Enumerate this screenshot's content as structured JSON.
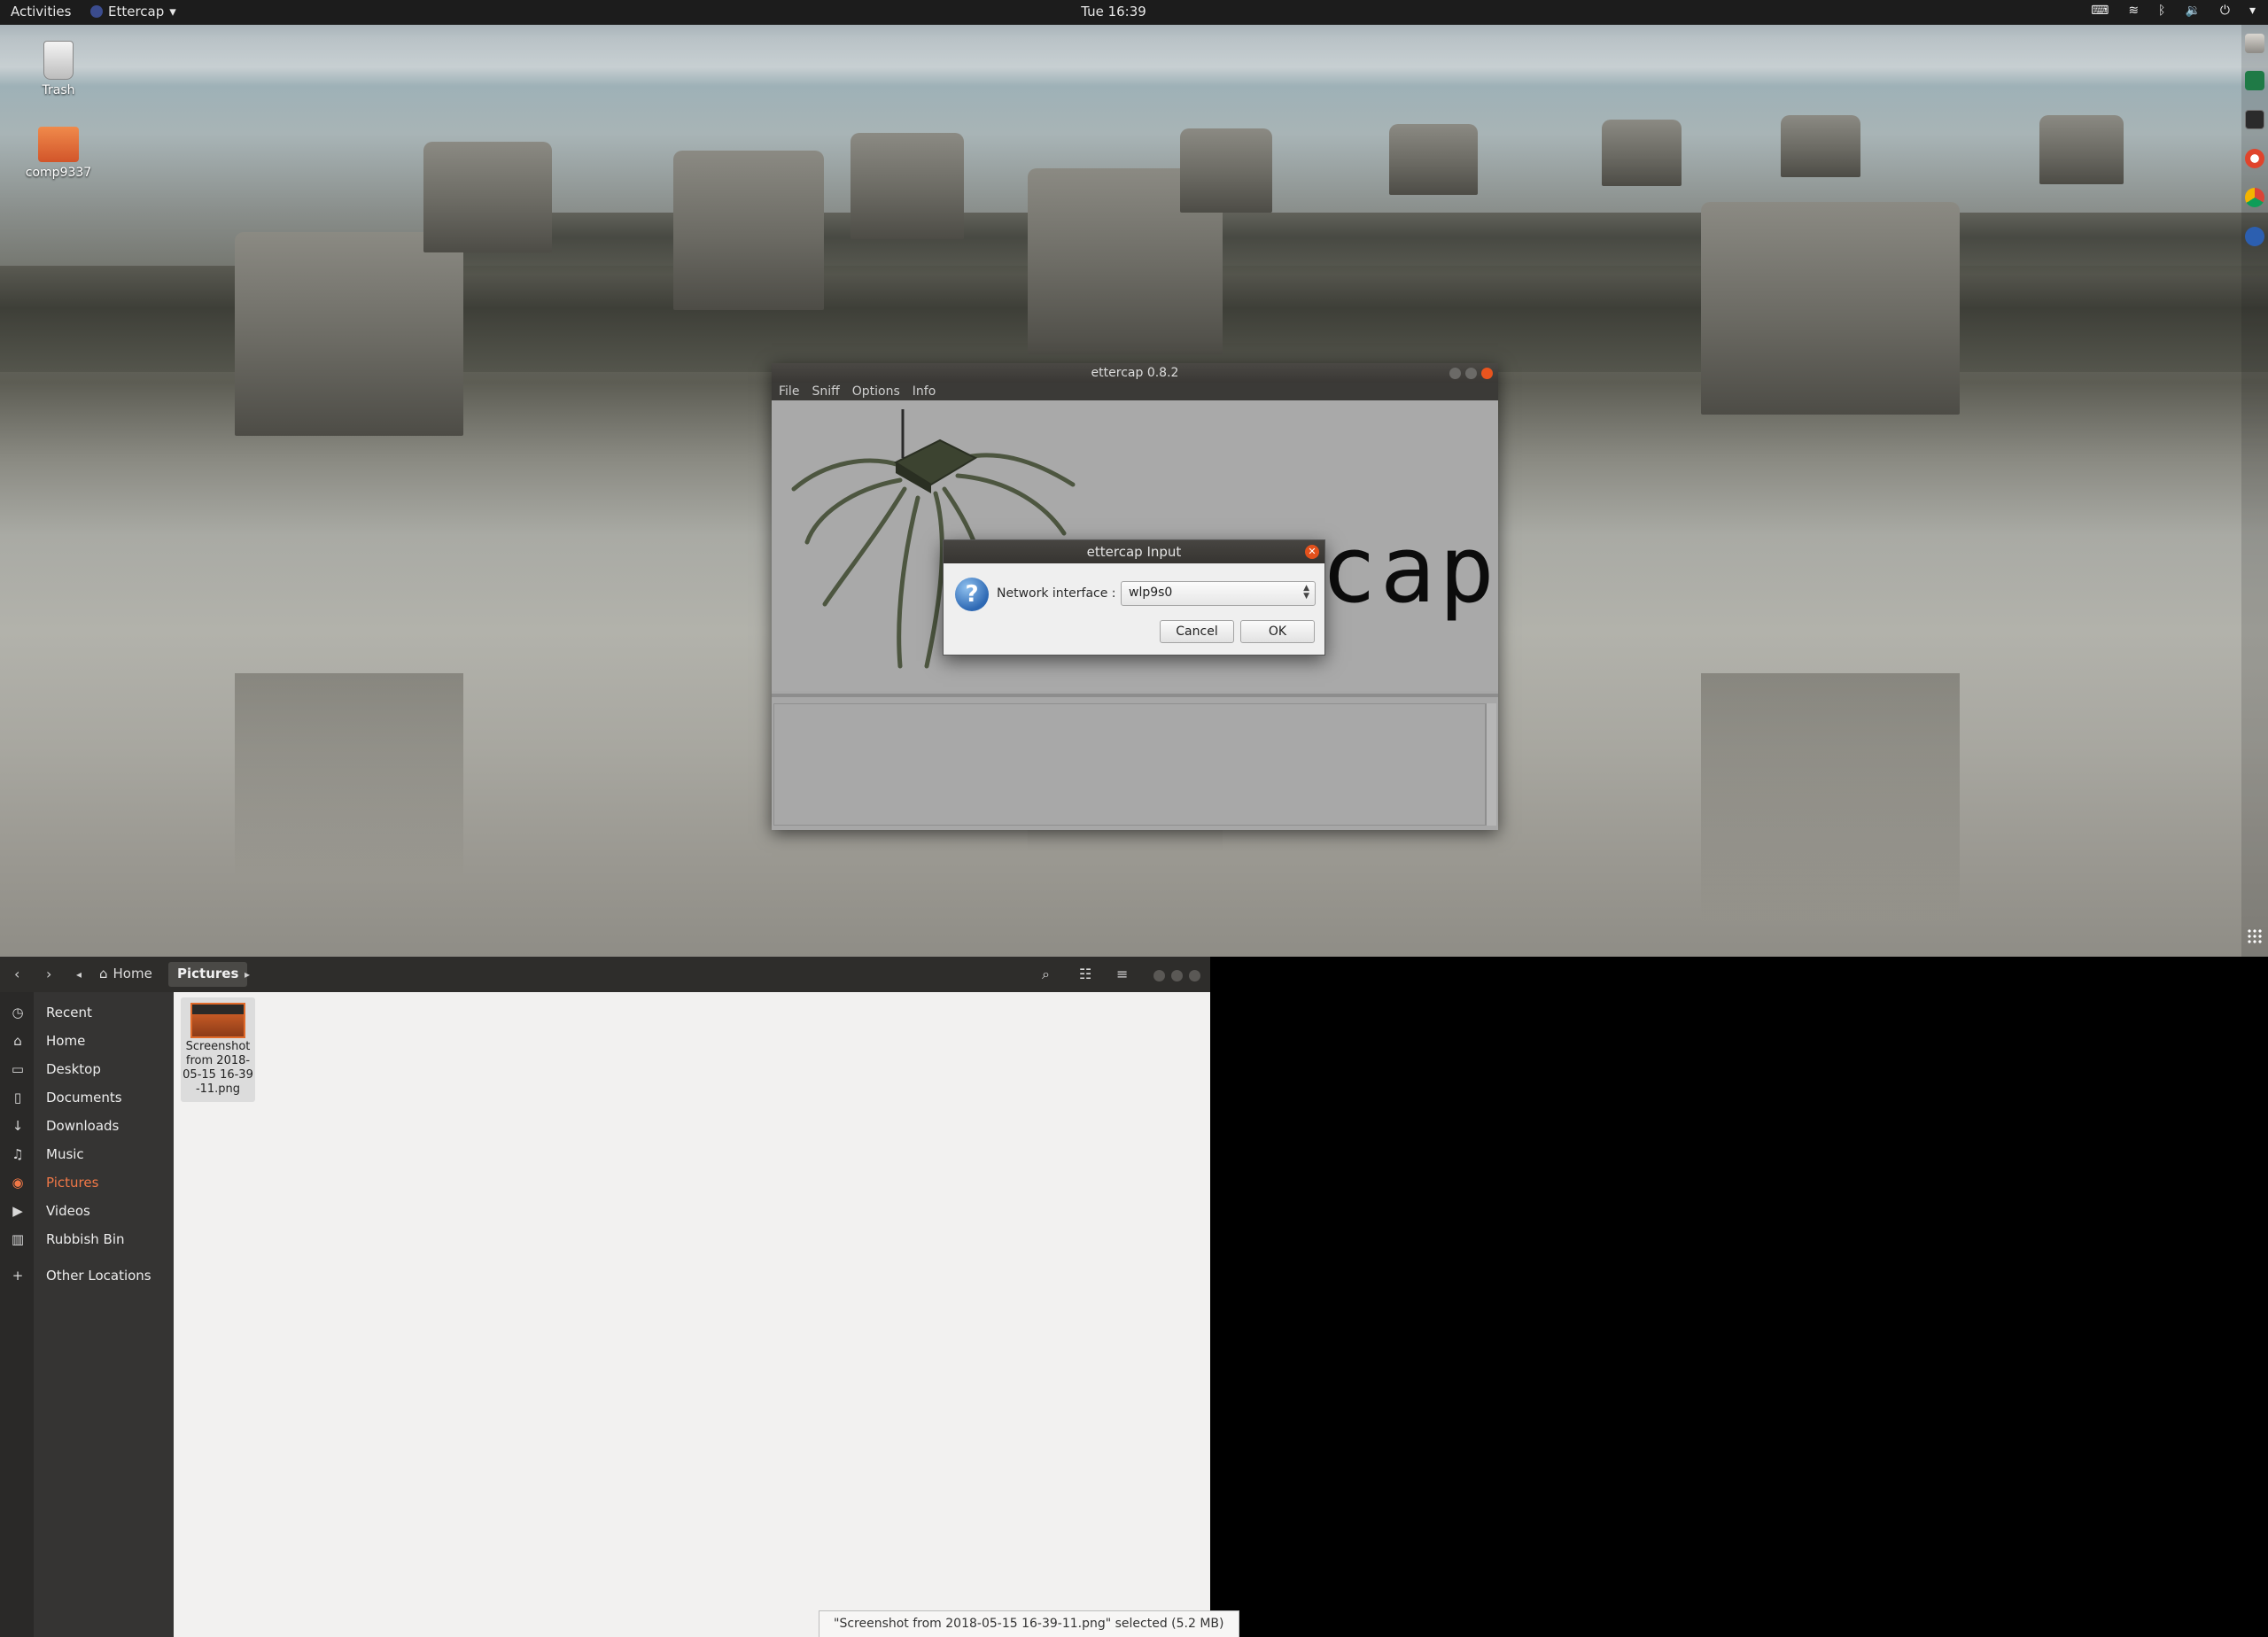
{
  "topbar": {
    "activities": "Activities",
    "app_name": "Ettercap",
    "clock": "Tue 16:39"
  },
  "desktop": {
    "icons": [
      {
        "label": "Trash",
        "icon": "trash-icon"
      },
      {
        "label": "comp9337",
        "icon": "folder-icon"
      }
    ]
  },
  "dock": {
    "items": [
      "files-icon",
      "pycharm-icon",
      "terminal-icon",
      "cutter-icon",
      "chrome-icon",
      "ettercap-icon"
    ]
  },
  "ettercap": {
    "title": "ettercap 0.8.2",
    "menu": [
      "File",
      "Sniff",
      "Options",
      "Info"
    ],
    "logo_text": "cap"
  },
  "dialog": {
    "title": "ettercap Input",
    "label": "Network interface :",
    "selected": "wlp9s0",
    "cancel": "Cancel",
    "ok": "OK"
  },
  "files": {
    "breadcrumb": {
      "home": "Home",
      "current": "Pictures"
    },
    "sidebar": [
      {
        "label": "Recent",
        "icon": "clock-icon"
      },
      {
        "label": "Home",
        "icon": "home-icon"
      },
      {
        "label": "Desktop",
        "icon": "folder-icon"
      },
      {
        "label": "Documents",
        "icon": "document-icon"
      },
      {
        "label": "Downloads",
        "icon": "download-icon"
      },
      {
        "label": "Music",
        "icon": "music-icon"
      },
      {
        "label": "Pictures",
        "icon": "camera-icon"
      },
      {
        "label": "Videos",
        "icon": "video-icon"
      },
      {
        "label": "Rubbish Bin",
        "icon": "trash-icon"
      },
      {
        "label": "Other Locations",
        "icon": "plus-icon"
      }
    ],
    "file_name": "Screenshot from 2018-05-15 16-39-11.png",
    "status": "\"Screenshot from 2018-05-15 16-39-11.png\" selected  (5.2 MB)"
  },
  "colors": {
    "accent": "#f07847",
    "close": "#e9541e",
    "topbar": "#1c1c1c"
  }
}
